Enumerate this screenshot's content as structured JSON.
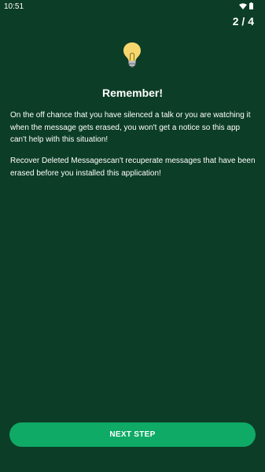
{
  "status_bar": {
    "time": "10:51",
    "icons": [
      "wifi-icon",
      "battery-icon"
    ]
  },
  "header": {
    "step_counter": "2 / 4"
  },
  "main": {
    "icon": "lightbulb-icon",
    "title": "Remember!",
    "paragraphs": [
      "On the off chance that you have silenced a talk or you are watching it when the message gets erased, you won't get a notice so this app can't help with this situation!",
      "Recover Deleted Messagescan't recuperate messages that have been erased before you installed this application!"
    ]
  },
  "footer": {
    "next_label": "NEXT STEP"
  },
  "colors": {
    "background": "#0c3d26",
    "button": "#0eaa66",
    "text": "#ffffff",
    "bulb": "#f5d76e"
  }
}
